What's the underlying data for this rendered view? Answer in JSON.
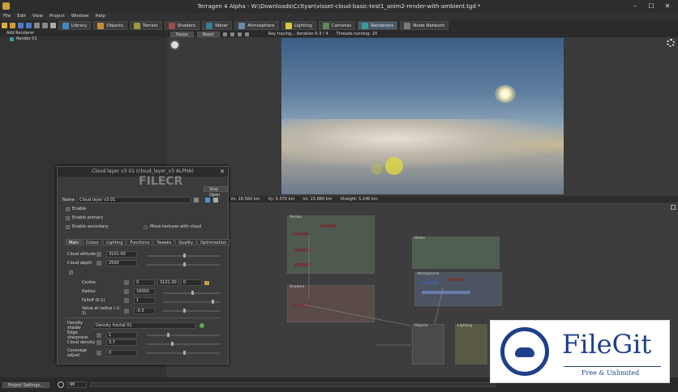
{
  "window": {
    "title": "Terragen 4 Alpha - W:\\Downloads\\Ccltyan\\visset-cloud-basic-test1_anim2-render-with-ambient.tgd *",
    "min": "–",
    "max": "☐",
    "close": "✕"
  },
  "menu": [
    "File",
    "Edit",
    "View",
    "Project",
    "Window",
    "Help"
  ],
  "toolbar": {
    "library": "Library",
    "tabs": [
      "Objects",
      "Terrain",
      "Shaders",
      "Water",
      "Atmosphere",
      "Lighting",
      "Cameras",
      "Renderers",
      "Node Network"
    ],
    "colors": [
      "#c88a3a",
      "#9a9a3a",
      "#7a3a3a",
      "#3a7a9a",
      "#3a7a9a",
      "#c8c83a",
      "#5a8a5a",
      "#3a9a9a",
      "#7a7a7a"
    ]
  },
  "left_panel": {
    "header": "Add Renderer",
    "item": "Render 01"
  },
  "viewport": {
    "pause": "Pause",
    "reset": "Reset",
    "status": "Ray tracing... iteration 0-3 / 4",
    "threads": "Threads running: 20",
    "stats": [
      "Vx: 16.560 km",
      "Vy: 5.370 km",
      "Vz: 15.880 km",
      "Vheight: 5.240 km"
    ]
  },
  "dialog": {
    "title": "Cloud layer v3 01 (cloud_layer_v3 ALPHA)",
    "name_label": "Name",
    "name_value": "Cloud layer v3 01",
    "stay_open": "Stay Open",
    "checks": [
      "Enable",
      "Enable primary",
      "Enable secondary"
    ],
    "move_textures": "Move textures with cloud",
    "tabs": [
      "Main",
      "Colour",
      "Lighting",
      "Functions",
      "Tweaks",
      "Quality",
      "Optimization"
    ],
    "fields": {
      "cloud_altitude": {
        "label": "Cloud altitude",
        "value": "3101.00"
      },
      "cloud_depth": {
        "label": "Cloud depth",
        "value": "2500"
      },
      "centre": {
        "label": "Centre",
        "x": "0",
        "y": "3101.00",
        "z": "0"
      },
      "radius": {
        "label": "Radius",
        "value": "16000"
      },
      "falloff": {
        "label": "Falloff (0-1)",
        "value": "1"
      },
      "value_radius": {
        "label": "Value at radius (-1-2)",
        "value": "-0.5"
      },
      "density_shader": {
        "label": "Density shader",
        "value": "Density fractal 01"
      },
      "edge_sharpness": {
        "label": "Edge sharpness",
        "value": "1"
      },
      "cloud_density": {
        "label": "Cloud density",
        "value": "3.7"
      },
      "coverage_adjust": {
        "label": "Coverage adjust",
        "value": "0"
      }
    }
  },
  "nodes": {
    "terrain": "Terrain",
    "shaders": "Shaders",
    "water": "Water",
    "atmosphere": "Atmosphere",
    "objects": "Objects",
    "lighting": "Lighting"
  },
  "bottom": {
    "project_settings": "Project Settings...",
    "frame": "96"
  },
  "watermark": {
    "brand": "FileGit",
    "tagline": "Free & Unlimited",
    "overlay": "FILECR"
  }
}
